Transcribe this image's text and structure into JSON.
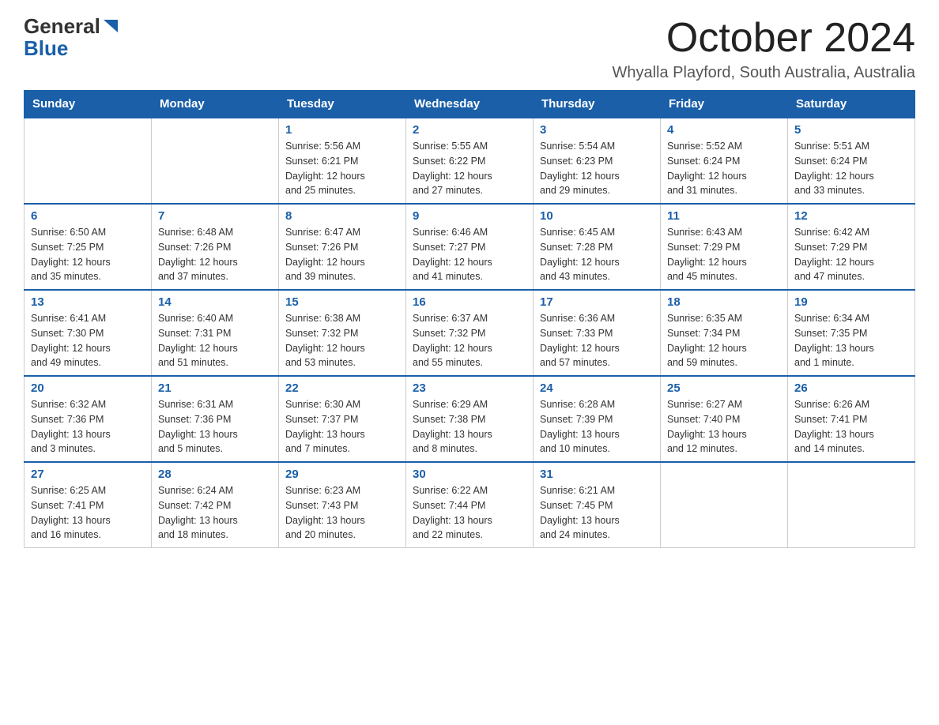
{
  "header": {
    "logo_general": "General",
    "logo_blue": "Blue",
    "month": "October 2024",
    "location": "Whyalla Playford, South Australia, Australia"
  },
  "weekdays": [
    "Sunday",
    "Monday",
    "Tuesday",
    "Wednesday",
    "Thursday",
    "Friday",
    "Saturday"
  ],
  "weeks": [
    [
      {
        "day": "",
        "info": ""
      },
      {
        "day": "",
        "info": ""
      },
      {
        "day": "1",
        "info": "Sunrise: 5:56 AM\nSunset: 6:21 PM\nDaylight: 12 hours\nand 25 minutes."
      },
      {
        "day": "2",
        "info": "Sunrise: 5:55 AM\nSunset: 6:22 PM\nDaylight: 12 hours\nand 27 minutes."
      },
      {
        "day": "3",
        "info": "Sunrise: 5:54 AM\nSunset: 6:23 PM\nDaylight: 12 hours\nand 29 minutes."
      },
      {
        "day": "4",
        "info": "Sunrise: 5:52 AM\nSunset: 6:24 PM\nDaylight: 12 hours\nand 31 minutes."
      },
      {
        "day": "5",
        "info": "Sunrise: 5:51 AM\nSunset: 6:24 PM\nDaylight: 12 hours\nand 33 minutes."
      }
    ],
    [
      {
        "day": "6",
        "info": "Sunrise: 6:50 AM\nSunset: 7:25 PM\nDaylight: 12 hours\nand 35 minutes."
      },
      {
        "day": "7",
        "info": "Sunrise: 6:48 AM\nSunset: 7:26 PM\nDaylight: 12 hours\nand 37 minutes."
      },
      {
        "day": "8",
        "info": "Sunrise: 6:47 AM\nSunset: 7:26 PM\nDaylight: 12 hours\nand 39 minutes."
      },
      {
        "day": "9",
        "info": "Sunrise: 6:46 AM\nSunset: 7:27 PM\nDaylight: 12 hours\nand 41 minutes."
      },
      {
        "day": "10",
        "info": "Sunrise: 6:45 AM\nSunset: 7:28 PM\nDaylight: 12 hours\nand 43 minutes."
      },
      {
        "day": "11",
        "info": "Sunrise: 6:43 AM\nSunset: 7:29 PM\nDaylight: 12 hours\nand 45 minutes."
      },
      {
        "day": "12",
        "info": "Sunrise: 6:42 AM\nSunset: 7:29 PM\nDaylight: 12 hours\nand 47 minutes."
      }
    ],
    [
      {
        "day": "13",
        "info": "Sunrise: 6:41 AM\nSunset: 7:30 PM\nDaylight: 12 hours\nand 49 minutes."
      },
      {
        "day": "14",
        "info": "Sunrise: 6:40 AM\nSunset: 7:31 PM\nDaylight: 12 hours\nand 51 minutes."
      },
      {
        "day": "15",
        "info": "Sunrise: 6:38 AM\nSunset: 7:32 PM\nDaylight: 12 hours\nand 53 minutes."
      },
      {
        "day": "16",
        "info": "Sunrise: 6:37 AM\nSunset: 7:32 PM\nDaylight: 12 hours\nand 55 minutes."
      },
      {
        "day": "17",
        "info": "Sunrise: 6:36 AM\nSunset: 7:33 PM\nDaylight: 12 hours\nand 57 minutes."
      },
      {
        "day": "18",
        "info": "Sunrise: 6:35 AM\nSunset: 7:34 PM\nDaylight: 12 hours\nand 59 minutes."
      },
      {
        "day": "19",
        "info": "Sunrise: 6:34 AM\nSunset: 7:35 PM\nDaylight: 13 hours\nand 1 minute."
      }
    ],
    [
      {
        "day": "20",
        "info": "Sunrise: 6:32 AM\nSunset: 7:36 PM\nDaylight: 13 hours\nand 3 minutes."
      },
      {
        "day": "21",
        "info": "Sunrise: 6:31 AM\nSunset: 7:36 PM\nDaylight: 13 hours\nand 5 minutes."
      },
      {
        "day": "22",
        "info": "Sunrise: 6:30 AM\nSunset: 7:37 PM\nDaylight: 13 hours\nand 7 minutes."
      },
      {
        "day": "23",
        "info": "Sunrise: 6:29 AM\nSunset: 7:38 PM\nDaylight: 13 hours\nand 8 minutes."
      },
      {
        "day": "24",
        "info": "Sunrise: 6:28 AM\nSunset: 7:39 PM\nDaylight: 13 hours\nand 10 minutes."
      },
      {
        "day": "25",
        "info": "Sunrise: 6:27 AM\nSunset: 7:40 PM\nDaylight: 13 hours\nand 12 minutes."
      },
      {
        "day": "26",
        "info": "Sunrise: 6:26 AM\nSunset: 7:41 PM\nDaylight: 13 hours\nand 14 minutes."
      }
    ],
    [
      {
        "day": "27",
        "info": "Sunrise: 6:25 AM\nSunset: 7:41 PM\nDaylight: 13 hours\nand 16 minutes."
      },
      {
        "day": "28",
        "info": "Sunrise: 6:24 AM\nSunset: 7:42 PM\nDaylight: 13 hours\nand 18 minutes."
      },
      {
        "day": "29",
        "info": "Sunrise: 6:23 AM\nSunset: 7:43 PM\nDaylight: 13 hours\nand 20 minutes."
      },
      {
        "day": "30",
        "info": "Sunrise: 6:22 AM\nSunset: 7:44 PM\nDaylight: 13 hours\nand 22 minutes."
      },
      {
        "day": "31",
        "info": "Sunrise: 6:21 AM\nSunset: 7:45 PM\nDaylight: 13 hours\nand 24 minutes."
      },
      {
        "day": "",
        "info": ""
      },
      {
        "day": "",
        "info": ""
      }
    ]
  ]
}
